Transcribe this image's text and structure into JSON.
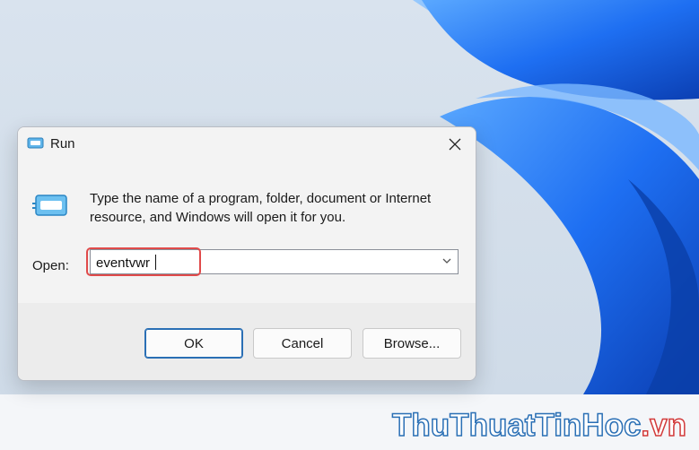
{
  "dialog": {
    "title": "Run",
    "description": "Type the name of a program, folder, document or Internet resource, and Windows will open it for you.",
    "open_label": "Open:",
    "input_value": "eventvwr",
    "buttons": {
      "ok": "OK",
      "cancel": "Cancel",
      "browse": "Browse..."
    }
  },
  "watermark": {
    "main": "ThuThuatTinHoc",
    "suffix": ".vn"
  },
  "colors": {
    "highlight_border": "#e04a4a",
    "primary_button_border": "#2a6fb5",
    "wallpaper_blue": "#1f6fe0"
  },
  "icons": [
    "run-app-icon",
    "close-icon",
    "chevron-down-icon"
  ]
}
